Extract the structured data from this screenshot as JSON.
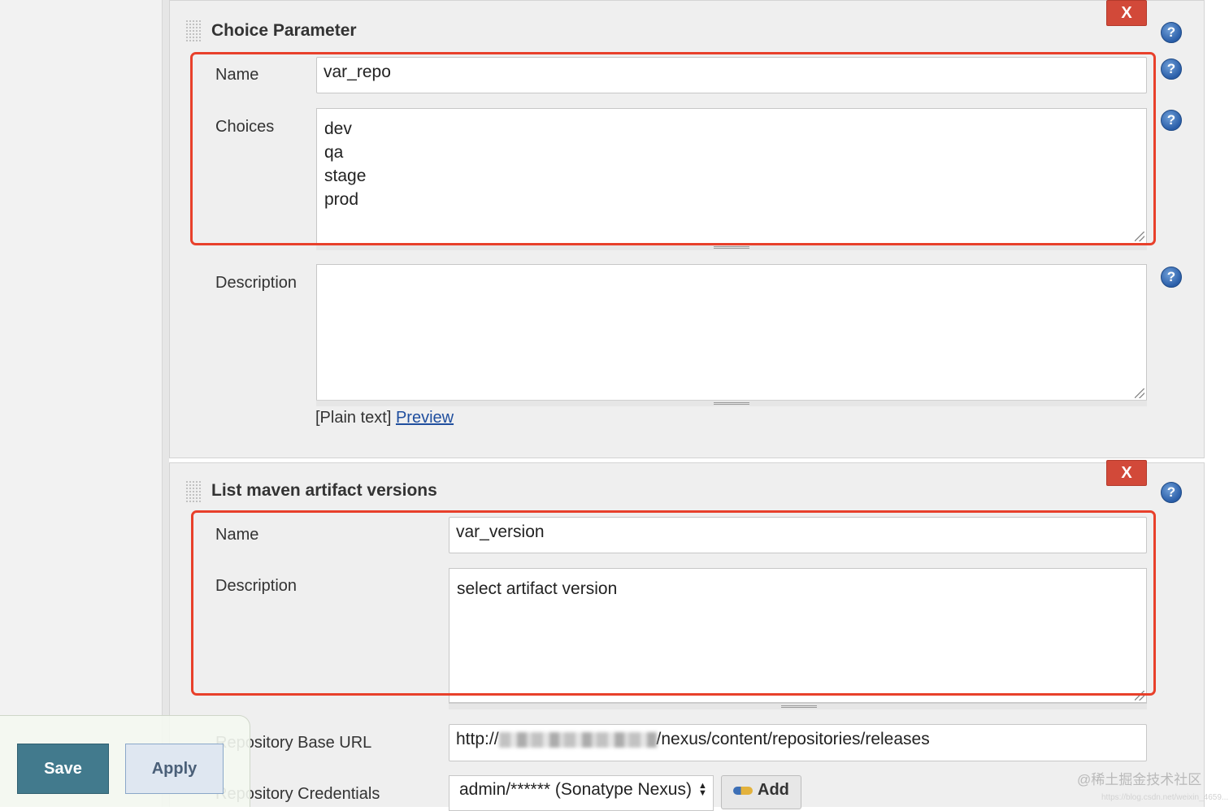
{
  "choice_param": {
    "title": "Choice Parameter",
    "delete_label": "X",
    "name_label": "Name",
    "name_value": "var_repo",
    "choices_label": "Choices",
    "choices": [
      "dev",
      "qa",
      "stage",
      "prod"
    ],
    "description_label": "Description",
    "description_value": "",
    "format_prefix": "[Plain text]",
    "preview_link": "Preview"
  },
  "maven_param": {
    "title": "List maven artifact versions",
    "delete_label": "X",
    "name_label": "Name",
    "name_value": "var_version",
    "description_label": "Description",
    "description_value": "select artifact version",
    "repo_url_label": "Repository Base URL",
    "repo_url_prefix": "http://",
    "repo_url_suffix": "/nexus/content/repositories/releases",
    "credentials_label": "Repository Credentials",
    "credentials_value": "admin/****** (Sonatype Nexus)",
    "add_label": "Add"
  },
  "help_glyph": "?",
  "actions": {
    "save_label": "Save",
    "apply_label": "Apply"
  },
  "watermark": {
    "text": "@稀土掘金技术社区",
    "subtext": "https://blog.csdn.net/weixin_4659..."
  },
  "colors": {
    "delete_red": "#d24939",
    "highlight_red": "#e8402b",
    "save_teal": "#427a8d",
    "help_blue": "#2a5ea8",
    "link_blue": "#1f4e9e"
  },
  "icons": [
    "drag-handle-icon",
    "help-icon",
    "resize-grip-icon",
    "key-icon",
    "select-arrows-icon"
  ]
}
